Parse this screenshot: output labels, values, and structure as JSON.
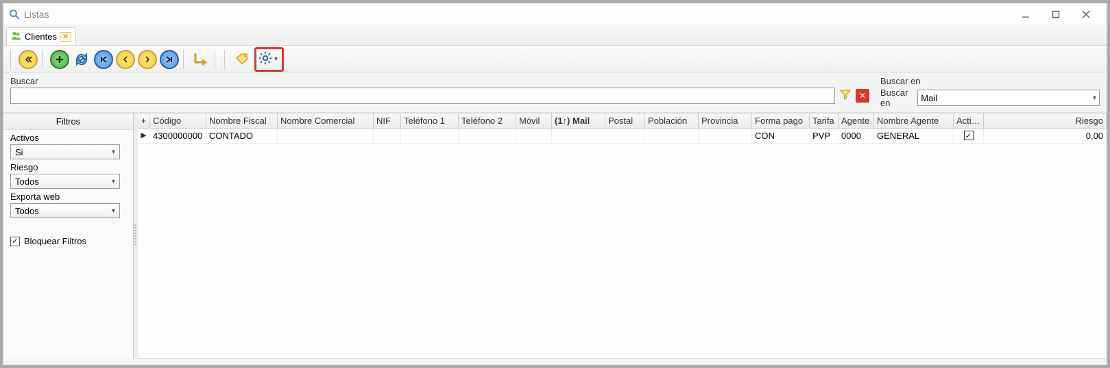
{
  "window": {
    "title": "Listas"
  },
  "tab": {
    "label": "Clientes"
  },
  "search": {
    "label": "Buscar",
    "value": "",
    "searchin_group": "Buscar en",
    "searchin_label": "Buscar en",
    "searchin_value": "Mail"
  },
  "filters": {
    "header": "Filtros",
    "activos_label": "Activos",
    "activos_value": "Si",
    "riesgo_label": "Riesgo",
    "riesgo_value": "Todos",
    "exporta_label": "Exporta web",
    "exporta_value": "Todos",
    "bloquear_label": "Bloquear Filtros",
    "bloquear_checked": true
  },
  "grid": {
    "plus": "+",
    "columns": [
      "Código",
      "Nombre Fiscal",
      "Nombre Comercial",
      "NIF",
      "Teléfono 1",
      "Teléfono 2",
      "Móvil",
      "(1↑) Mail",
      "Postal",
      "Población",
      "Provincia",
      "Forma pago",
      "Tarifa",
      "Agente",
      "Nombre Agente",
      "Activo",
      "Riesgo"
    ],
    "row": {
      "codigo": "4300000000",
      "nombre_fiscal": "CONTADO",
      "nombre_comercial": "",
      "nif": "",
      "telefono1": "",
      "telefono2": "",
      "movil": "",
      "mail": "",
      "postal": "",
      "poblacion": "",
      "provincia": "",
      "forma_pago": "CON",
      "tarifa": "PVP",
      "agente": "0000",
      "nombre_agente": "GENERAL",
      "activo": true,
      "riesgo": "0,00"
    }
  }
}
